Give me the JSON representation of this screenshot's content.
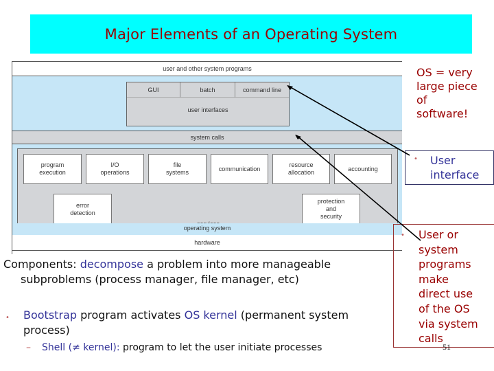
{
  "slide": {
    "title": "Major Elements of an Operating System",
    "page_number": "51",
    "colors": {
      "title_bg": "#00ffff",
      "title_text": "#990000",
      "highlight_blue": "#333399",
      "callout_red": "#990000"
    }
  },
  "diagram": {
    "top_layer": "user and other system programs",
    "user_interfaces": {
      "cells": [
        "GUI",
        "batch",
        "command line"
      ],
      "label": "user interfaces"
    },
    "system_calls": "system calls",
    "services": {
      "label": "services",
      "row1": [
        "program\nexecution",
        "I/O\noperations",
        "file\nsystems",
        "communication",
        "resource\nallocation",
        "accounting"
      ],
      "row2": [
        "error\ndetection",
        "protection\nand\nsecurity"
      ]
    },
    "operating_system": "operating system",
    "hardware": "hardware"
  },
  "callouts": {
    "os_large": "OS = very\nlarge piece\nof\nsoftware!",
    "user_interface": "User\ninterface",
    "system_programs": "User or\nsystem\nprograms\nmake\ndirect use\nof the OS\nvia system\ncalls",
    "bullet": "•"
  },
  "body": {
    "components_label": "Components: ",
    "components_highlight": "decompose",
    "components_rest": " a problem into more manageable",
    "components_line2": "subproblems (process manager, file manager, etc)",
    "bullet": "•",
    "bootstrap_highlight": "Bootstrap",
    "bootstrap_mid": " program activates ",
    "kernel_highlight": "OS kernel",
    "bootstrap_rest": " (permanent system",
    "bootstrap_line2": "process)",
    "dash": "–",
    "shell_highlight": "Shell (≠ kernel):",
    "shell_rest": " program to let the user initiate processes"
  }
}
